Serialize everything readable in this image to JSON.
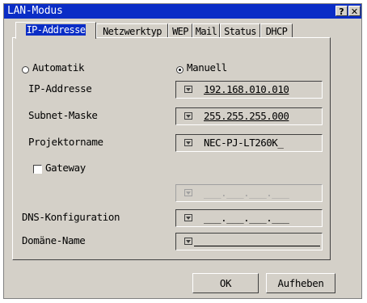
{
  "window": {
    "title": "LAN-Modus",
    "help_glyph": "?",
    "close_glyph": "✕"
  },
  "tabs": [
    {
      "label": "IP-Addresse",
      "active": true
    },
    {
      "label": "Netzwerktyp",
      "active": false
    },
    {
      "label": "WEP",
      "active": false
    },
    {
      "label": "Mail",
      "active": false
    },
    {
      "label": "Status",
      "active": false
    },
    {
      "label": "DHCP",
      "active": false
    }
  ],
  "mode": {
    "automatic_label": "Automatik",
    "manual_label": "Manuell",
    "selected": "Manuell"
  },
  "fields": {
    "ip_label": "IP-Addresse",
    "ip_value": "192.168.010.010",
    "subnet_label": "Subnet-Maske",
    "subnet_value": "255.255.255.000",
    "projector_label": "Projektorname",
    "projector_value": "NEC-PJ-LT260K_",
    "gateway_label": "Gateway",
    "gateway_checked": false,
    "gateway_value": "___.___.___.___",
    "dns_label": "DNS-Konfiguration",
    "dns_value": "___.___.___.___",
    "domain_label": "Domäne-Name",
    "domain_value": ""
  },
  "buttons": {
    "ok_label": "OK",
    "cancel_label": "Aufheben"
  }
}
